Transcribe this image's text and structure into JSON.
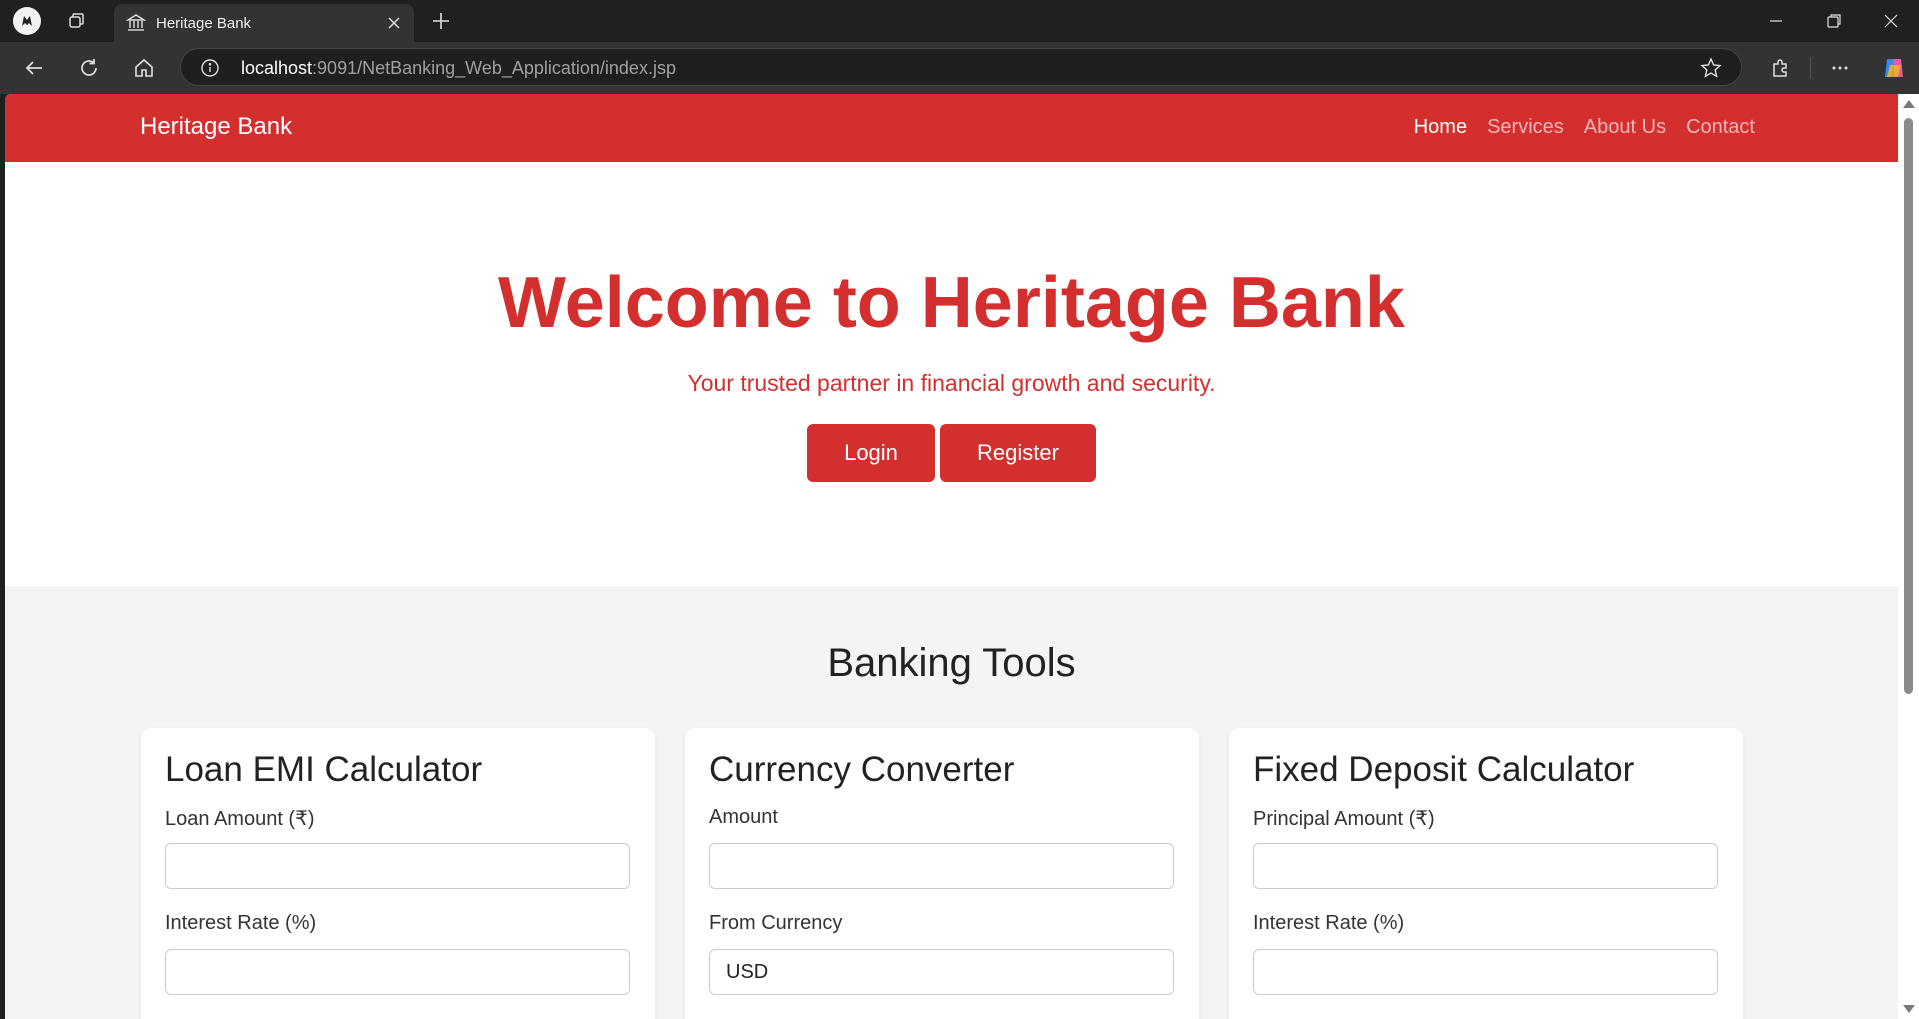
{
  "browser": {
    "tab_title": "Heritage Bank",
    "url_host": "localhost",
    "url_rest": ":9091/NetBanking_Web_Application/index.jsp"
  },
  "site": {
    "brand": "Heritage Bank",
    "nav": [
      "Home",
      "Services",
      "About Us",
      "Contact"
    ],
    "active_nav": "Home",
    "accent_color": "#d32f2f"
  },
  "hero": {
    "title": "Welcome to Heritage Bank",
    "subtitle": "Your trusted partner in financial growth and security.",
    "login_label": "Login",
    "register_label": "Register"
  },
  "tools": {
    "title": "Banking Tools",
    "cards": [
      {
        "title": "Loan EMI Calculator",
        "field1_label": "Loan Amount (₹)",
        "field1_value": "",
        "field2_label": "Interest Rate (%)",
        "field2_value": ""
      },
      {
        "title": "Currency Converter",
        "field1_label": "Amount",
        "field1_value": "",
        "field2_label": "From Currency",
        "field2_value": "USD"
      },
      {
        "title": "Fixed Deposit Calculator",
        "field1_label": "Principal Amount (₹)",
        "field1_value": "",
        "field2_label": "Interest Rate (%)",
        "field2_value": ""
      }
    ]
  }
}
